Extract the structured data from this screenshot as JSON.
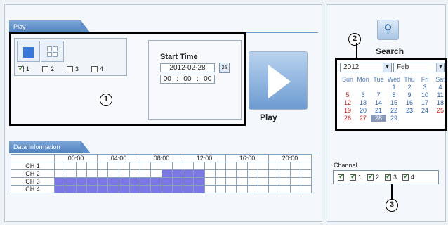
{
  "play": {
    "tab_label": "Play",
    "channels": [
      {
        "label": "1",
        "checked": true
      },
      {
        "label": "2",
        "checked": false
      },
      {
        "label": "3",
        "checked": false
      },
      {
        "label": "4",
        "checked": false
      }
    ],
    "annotation": "1",
    "start_time_label": "Start Time",
    "date_value": "2012-02-28",
    "calendar_button": "25",
    "time_hh": "00",
    "time_mm": "00",
    "time_ss": "00",
    "play_label": "Play"
  },
  "data_info": {
    "tab_label": "Data Information",
    "hours": [
      "00:00",
      "04:00",
      "08:00",
      "12:00",
      "16:00",
      "20:00"
    ],
    "rows": [
      {
        "label": "CH 1",
        "ranges": []
      },
      {
        "label": "CH 2",
        "ranges": [
          [
            10,
            14
          ]
        ]
      },
      {
        "label": "CH 3",
        "ranges": [
          [
            0,
            14
          ]
        ]
      },
      {
        "label": "CH 4",
        "ranges": [
          [
            0,
            14
          ]
        ]
      }
    ]
  },
  "search": {
    "annotation": "2",
    "label": "Search",
    "year": "2012",
    "month": "Feb",
    "weekdays": [
      "Sun",
      "Mon",
      "Tue",
      "Wed",
      "Thu",
      "Fri",
      "Sat"
    ],
    "weeks": [
      [
        "",
        "",
        "",
        "1",
        "2",
        "3",
        "4"
      ],
      [
        "5",
        "6",
        "7",
        "8",
        "9",
        "10",
        "11"
      ],
      [
        "12",
        "13",
        "14",
        "15",
        "16",
        "17",
        "18"
      ],
      [
        "19",
        "20",
        "21",
        "22",
        "23",
        "24",
        "25"
      ],
      [
        "26",
        "27",
        "28",
        "29",
        "",
        "",
        ""
      ]
    ],
    "selected_day": "28"
  },
  "channel": {
    "label": "Channel",
    "annotation": "3",
    "items": [
      {
        "label": "",
        "checked": true
      },
      {
        "label": "1",
        "checked": true
      },
      {
        "label": "2",
        "checked": true
      },
      {
        "label": "3",
        "checked": true
      },
      {
        "label": "4",
        "checked": true
      }
    ]
  },
  "colors": {
    "accent": "#4f7fbf",
    "data_fill": "#7b78e6",
    "weekend": "#d02020"
  }
}
